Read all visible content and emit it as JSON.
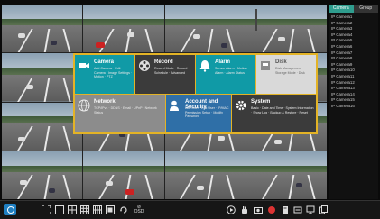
{
  "panel": {
    "tabs": [
      {
        "label": "Camera"
      },
      {
        "label": "Group"
      }
    ],
    "cameras": [
      "IP Camera1",
      "IP Camera2",
      "IP Camera3",
      "IP Camera4",
      "IP Camera5",
      "IP Camera6",
      "IP Camera7",
      "IP Camera8",
      "IP Camera9",
      "IP Camera10",
      "IP Camera11",
      "IP Camera12",
      "IP Camera13",
      "IP Camera14",
      "IP Camera15",
      "IP Camera16"
    ]
  },
  "menu": {
    "camera": {
      "title": "Camera",
      "desc": "Add Camera · Edit Camera · Image Settings · Motion · PTZ"
    },
    "record": {
      "title": "Record",
      "desc": "Record Mode · Record Schedule · Advanced"
    },
    "alarm": {
      "title": "Alarm",
      "desc": "Sensor Alarm · Motion Alarm · Alarm Status"
    },
    "disk": {
      "title": "Disk",
      "desc": "Disk Management · Storage Mode · Disk"
    },
    "network": {
      "title": "Network",
      "desc": "TCP/IPv4 · DDNS · Email · UPnP · Network Status"
    },
    "account": {
      "title": "Account and Security",
      "desc": "Add User · Edit User · IP/MAC Permission Setup · Modify Password"
    },
    "system": {
      "title": "System",
      "desc": "Basic · Date and Time · System Information · Show Log · Backup & Restore · Reset"
    }
  },
  "toolbar": {
    "audio_label": "⊘",
    "osd_label": "OSD"
  }
}
